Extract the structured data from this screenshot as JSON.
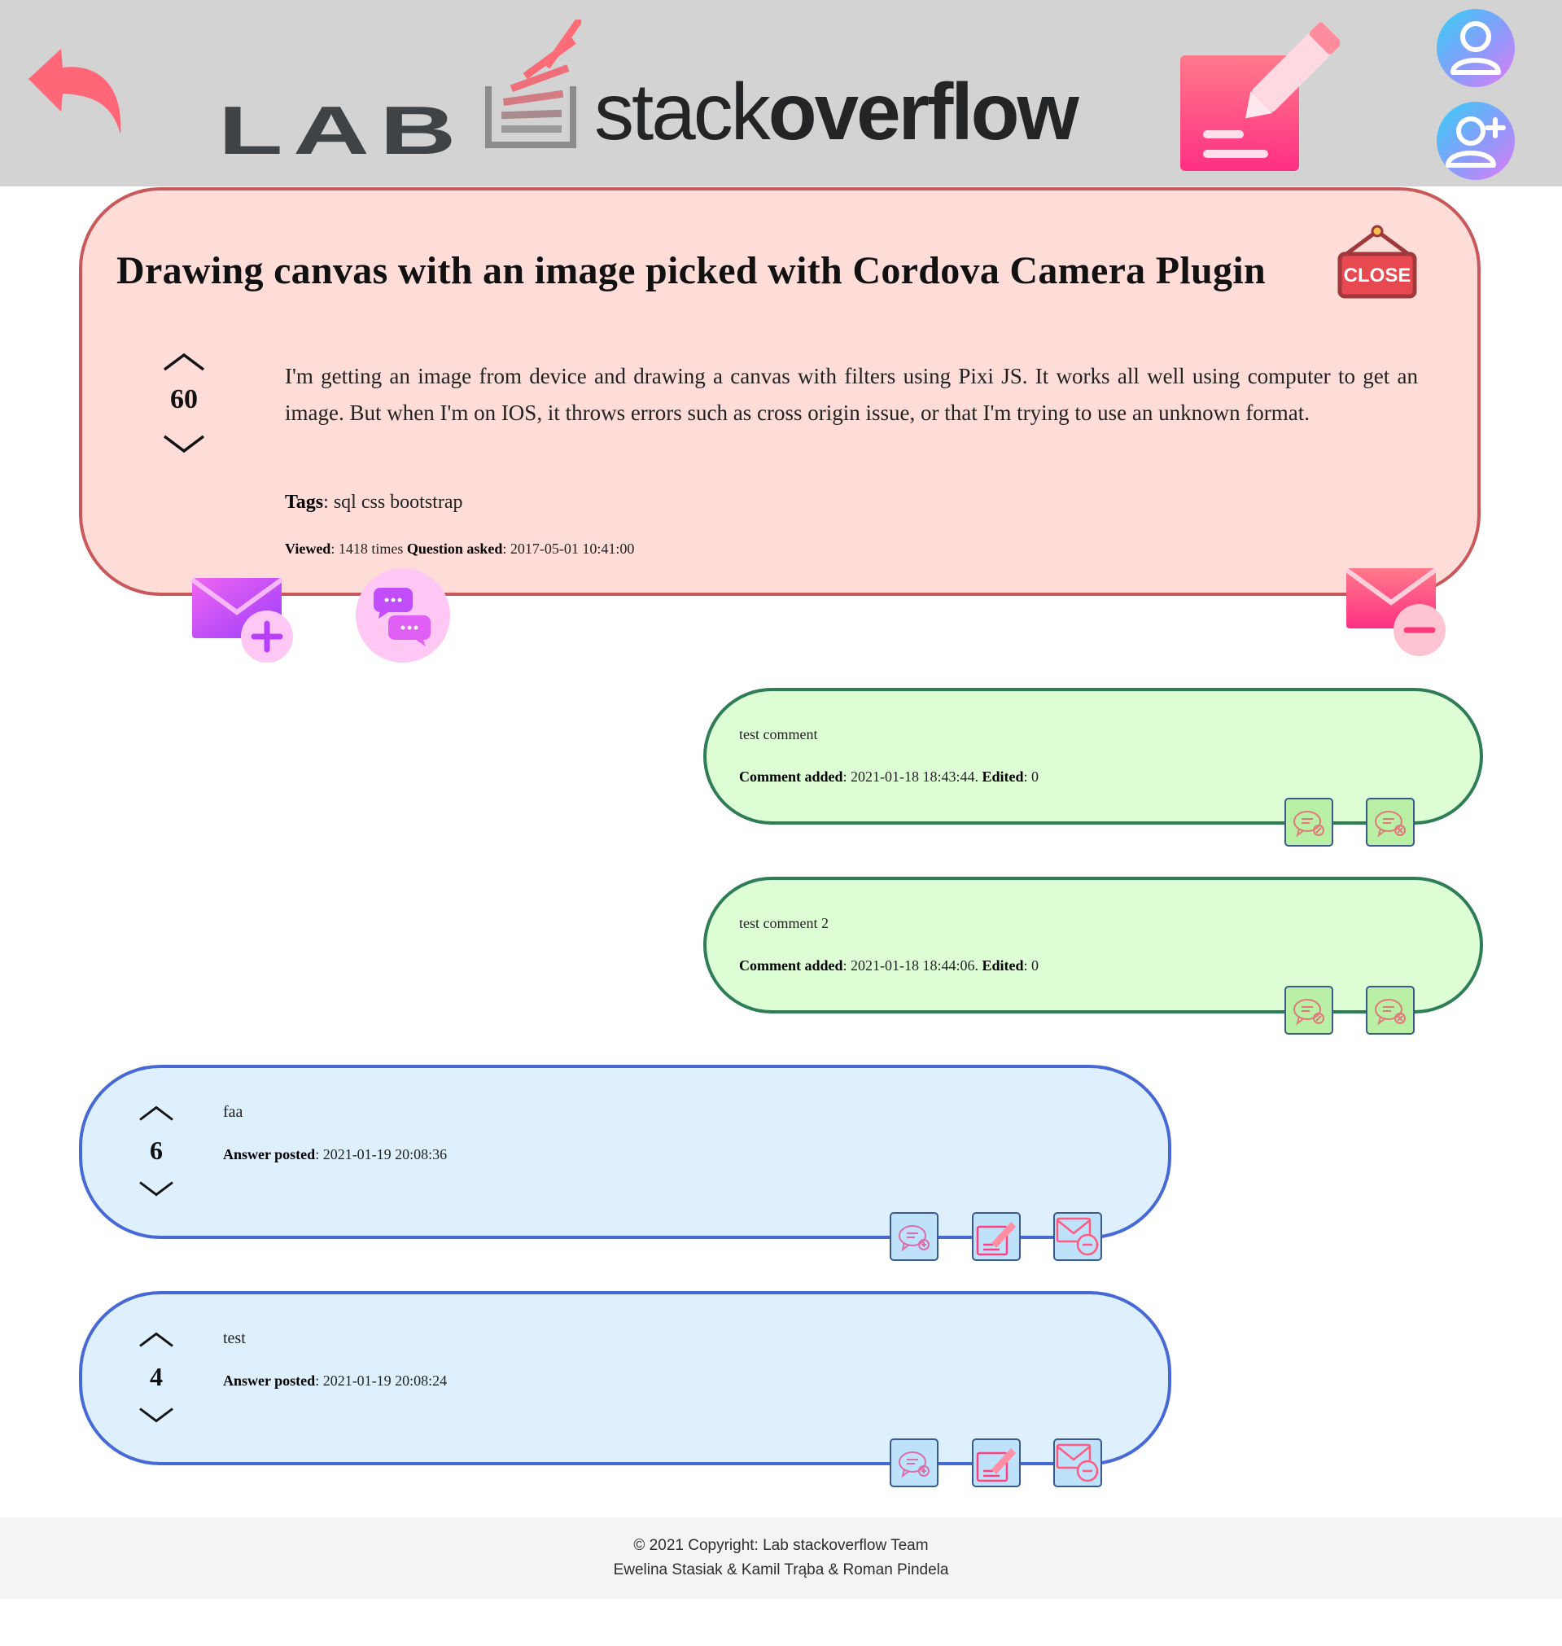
{
  "header": {
    "logo_lab": "LAB",
    "logo_stack": "stack",
    "logo_overflow": "overflow"
  },
  "question": {
    "title": "Drawing canvas with an image picked with Cordova Camera Plugin",
    "close_sign_label": "CLOSE",
    "votes": "60",
    "body": "I'm getting an image from device and drawing a canvas with filters using Pixi JS. It works all well using computer to get an image. But when I'm on IOS, it throws errors such as cross origin issue, or that I'm trying to use an unknown format.",
    "tags_label": "Tags",
    "tags": ": sql css bootstrap",
    "viewed_label": "Viewed",
    "viewed_value": ": 1418 times ",
    "asked_label": "Question asked",
    "asked_value": ": 2017-05-01 10:41:00"
  },
  "comments": [
    {
      "text": "test comment",
      "added_label": "Comment added",
      "added_value": ": 2021-01-18 18:43:44. ",
      "edited_label": "Edited",
      "edited_value": ": 0"
    },
    {
      "text": "test comment 2",
      "added_label": "Comment added",
      "added_value": ": 2021-01-18 18:44:06. ",
      "edited_label": "Edited",
      "edited_value": ": 0"
    }
  ],
  "answers": [
    {
      "votes": "6",
      "text": "faa",
      "posted_label": "Answer posted",
      "posted_value": ": 2021-01-19 20:08:36"
    },
    {
      "votes": "4",
      "text": "test",
      "posted_label": "Answer posted",
      "posted_value": ": 2021-01-19 20:08:24"
    }
  ],
  "footer": {
    "copyright": "© 2021 Copyright: Lab stackoverflow Team",
    "authors": "Ewelina Stasiak & Kamil Trąba & Roman Pindela"
  },
  "icons": {
    "back": "back-arrow-icon",
    "new_question": "edit-note-icon",
    "user": "user-icon",
    "add_user": "add-user-icon",
    "close": "close-sign-icon",
    "add_answer": "mail-add-icon",
    "add_comment": "chat-bubbles-icon",
    "delete": "mail-remove-icon",
    "edit_comment": "chat-edit-icon",
    "delete_comment": "chat-delete-icon"
  },
  "colors": {
    "header_bg": "#d3d3d3",
    "question_bg": "#fedcd8",
    "question_border": "#c9585a",
    "comment_bg": "#ddfdd4",
    "comment_border": "#2e7d56",
    "answer_bg": "#def0fd",
    "answer_border": "#4769d6",
    "accent_pink": "#ff4f86",
    "accent_purple": "#c24dfb"
  }
}
